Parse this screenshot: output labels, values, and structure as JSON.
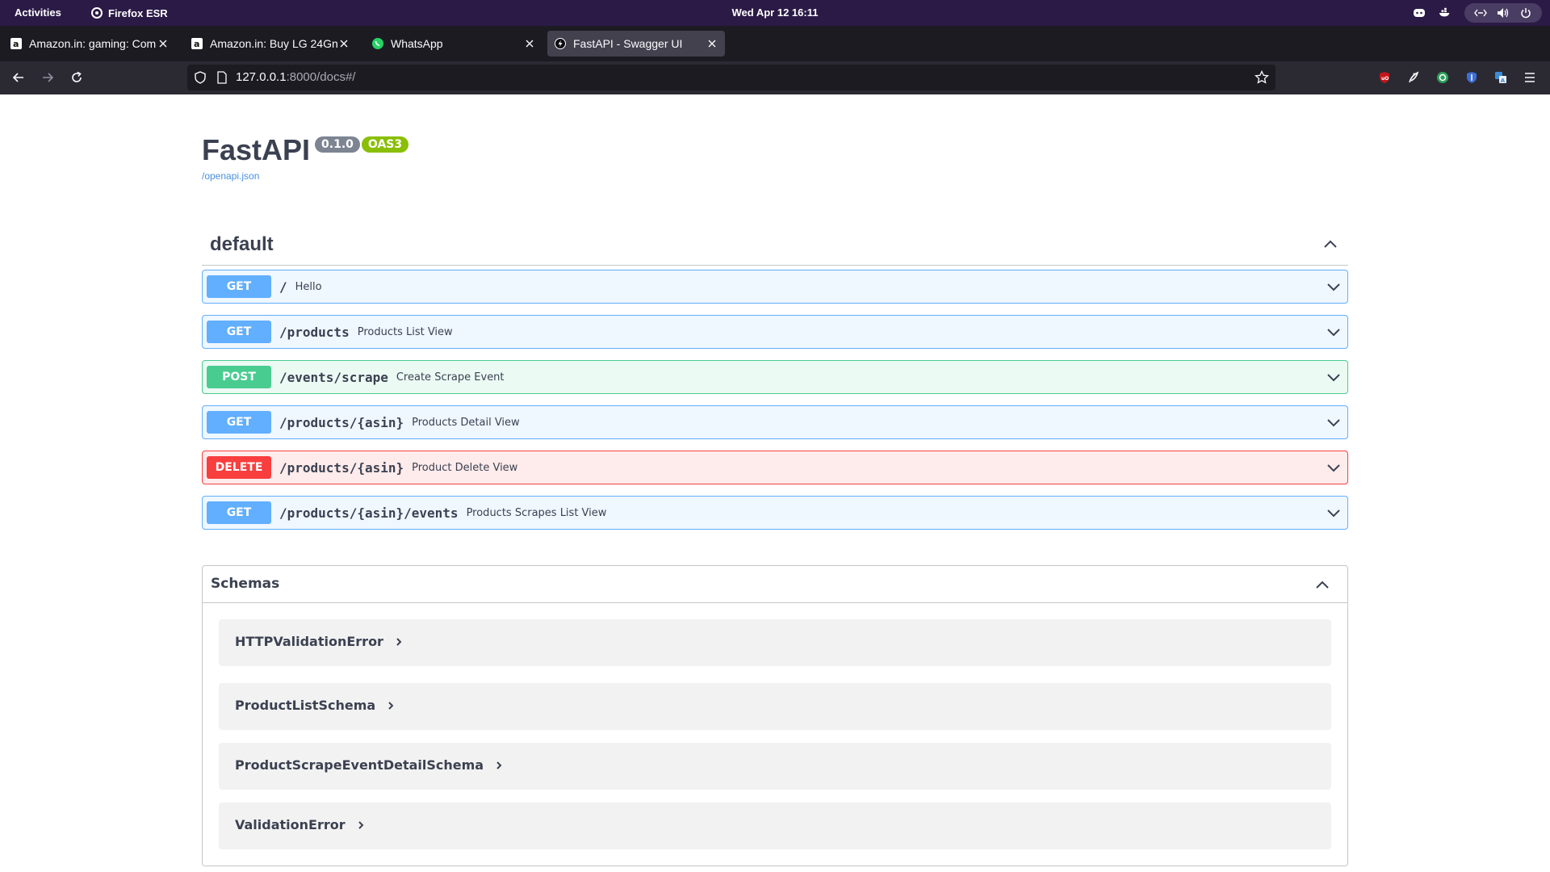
{
  "system_bar": {
    "activities": "Activities",
    "app_name": "Firefox ESR",
    "clock": "Wed Apr 12  16:11"
  },
  "browser": {
    "tabs": [
      {
        "title": "Amazon.in: gaming: Com",
        "favicon": "amazon-icon",
        "active": false
      },
      {
        "title": "Amazon.in: Buy LG 24Gn",
        "favicon": "amazon-icon",
        "active": false
      },
      {
        "title": "WhatsApp",
        "favicon": "whatsapp-icon",
        "active": false
      },
      {
        "title": "FastAPI - Swagger UI",
        "favicon": "fastapi-icon",
        "active": true
      }
    ],
    "url_host": "127.0.0.1",
    "url_rest": ":8000/docs#/"
  },
  "api_info": {
    "title": "FastAPI",
    "version": "0.1.0",
    "oas": "OAS3",
    "spec_url": "/openapi.json"
  },
  "tag": {
    "name": "default"
  },
  "operations": [
    {
      "method": "GET",
      "path": "/",
      "summary": "Hello",
      "kind": "get"
    },
    {
      "method": "GET",
      "path": "/products",
      "summary": "Products List View",
      "kind": "get"
    },
    {
      "method": "POST",
      "path": "/events/scrape",
      "summary": "Create Scrape Event",
      "kind": "post"
    },
    {
      "method": "GET",
      "path": "/products/{asin}",
      "summary": "Products Detail View",
      "kind": "get"
    },
    {
      "method": "DELETE",
      "path": "/products/{asin}",
      "summary": "Product Delete View",
      "kind": "delete"
    },
    {
      "method": "GET",
      "path": "/products/{asin}/events",
      "summary": "Products Scrapes List View",
      "kind": "get"
    }
  ],
  "schemas": {
    "title": "Schemas",
    "items": [
      {
        "name": "HTTPValidationError"
      },
      {
        "name": "ProductListSchema"
      },
      {
        "name": "ProductScrapeEventDetailSchema"
      },
      {
        "name": "ValidationError"
      }
    ]
  },
  "colors": {
    "get": "#61affe",
    "post": "#49cc90",
    "delete": "#f93e3e",
    "text": "#3b4151",
    "link": "#4990e2"
  }
}
